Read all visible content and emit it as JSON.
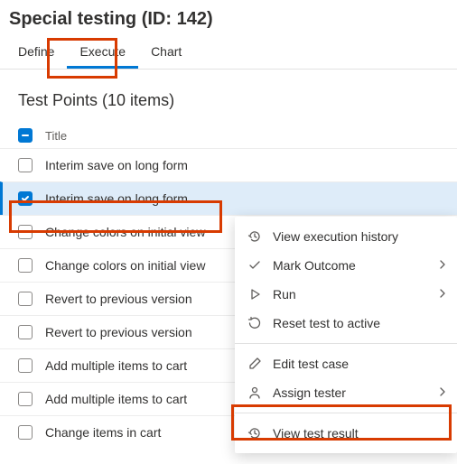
{
  "page": {
    "title": "Special testing (ID: 142)"
  },
  "tabs": {
    "items": [
      {
        "label": "Define"
      },
      {
        "label": "Execute"
      },
      {
        "label": "Chart"
      }
    ],
    "activeIndex": 1
  },
  "list": {
    "title": "Test Points (10 items)",
    "columns": {
      "title": "Title"
    },
    "selectAllState": "indeterminate",
    "rows": [
      {
        "title": "Interim save on long form",
        "checked": false
      },
      {
        "title": "Interim save on long form",
        "checked": true
      },
      {
        "title": "Change colors on initial view",
        "checked": false
      },
      {
        "title": "Change colors on initial view",
        "checked": false
      },
      {
        "title": "Revert to previous version",
        "checked": false
      },
      {
        "title": "Revert to previous version",
        "checked": false
      },
      {
        "title": "Add multiple items to cart",
        "checked": false
      },
      {
        "title": "Add multiple items to cart",
        "checked": false
      },
      {
        "title": "Change items in cart",
        "checked": false
      }
    ]
  },
  "contextMenu": {
    "items": [
      {
        "label": "View execution history",
        "icon": "history-icon",
        "hasSubmenu": false
      },
      {
        "label": "Mark Outcome",
        "icon": "check-icon",
        "hasSubmenu": true
      },
      {
        "label": "Run",
        "icon": "play-icon",
        "hasSubmenu": true
      },
      {
        "label": "Reset test to active",
        "icon": "reset-icon",
        "hasSubmenu": false
      },
      {
        "label": "Edit test case",
        "icon": "edit-icon",
        "hasSubmenu": false
      },
      {
        "label": "Assign tester",
        "icon": "person-icon",
        "hasSubmenu": true
      },
      {
        "label": "View test result",
        "icon": "history-icon",
        "hasSubmenu": false
      }
    ]
  }
}
